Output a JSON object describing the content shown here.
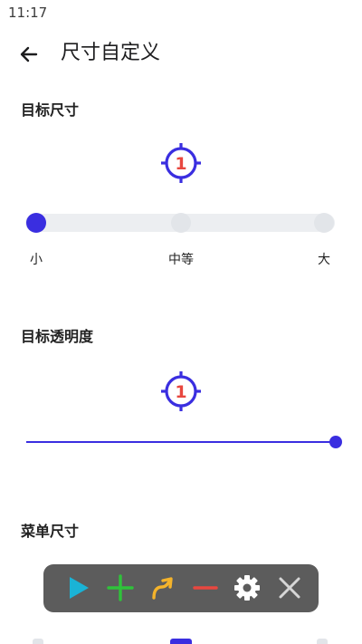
{
  "status": {
    "time": "11:17"
  },
  "header": {
    "title": "尺寸自定义"
  },
  "sections": {
    "target_size": {
      "title": "目标尺寸",
      "icon_label": "1",
      "options": [
        "小",
        "中等",
        "大"
      ],
      "selected_index": 0
    },
    "target_opacity": {
      "title": "目标透明度",
      "icon_label": "1",
      "value": 1.0
    },
    "menu_size": {
      "title": "菜单尺寸"
    }
  },
  "toolbar": {
    "items": [
      {
        "icon": "play-icon",
        "color": "#1ab3d6"
      },
      {
        "icon": "plus-icon",
        "color": "#2fc23a"
      },
      {
        "icon": "swipe-arrow-icon",
        "color": "#f4b32b"
      },
      {
        "icon": "minus-icon",
        "color": "#e8473f"
      },
      {
        "icon": "gear-icon",
        "color": "#ffffff"
      },
      {
        "icon": "close-icon",
        "color": "#d6d6d6"
      }
    ]
  },
  "colors": {
    "accent": "#3a2ee0",
    "icon_number": "#e8473f",
    "track": "#eceef1",
    "toolbar_bg": "#5c5c5c"
  }
}
